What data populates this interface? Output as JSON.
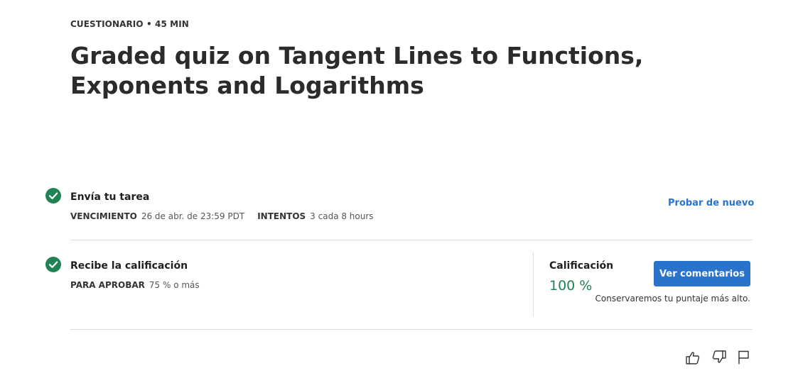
{
  "header": {
    "eyebrow": "CUESTIONARIO • 45 MIN",
    "title": "Graded quiz on Tangent Lines to Functions, Exponents and Logarithms"
  },
  "submit": {
    "title": "Envía tu tarea",
    "due_label": "VENCIMIENTO",
    "due_value": "26 de abr. de 23:59 PDT",
    "attempts_label": "INTENTOS",
    "attempts_value": "3 cada 8 hours",
    "retry_label": "Probar de nuevo",
    "status_icon": "check-circle-icon"
  },
  "receive": {
    "title": "Recibe la calificación",
    "pass_label": "PARA APROBAR",
    "pass_value": "75 % o más",
    "status_icon": "check-circle-icon"
  },
  "grade": {
    "label": "Calificación",
    "value": "100 %",
    "feedback_button": "Ver comentarios",
    "note": "Conservaremos tu puntaje más alto."
  },
  "footer": {
    "icons": [
      "thumbs-up-icon",
      "thumbs-down-icon",
      "flag-icon"
    ]
  },
  "colors": {
    "accent": "#2a73cc",
    "success": "#1f8354",
    "divider": "#dcdcdc"
  }
}
